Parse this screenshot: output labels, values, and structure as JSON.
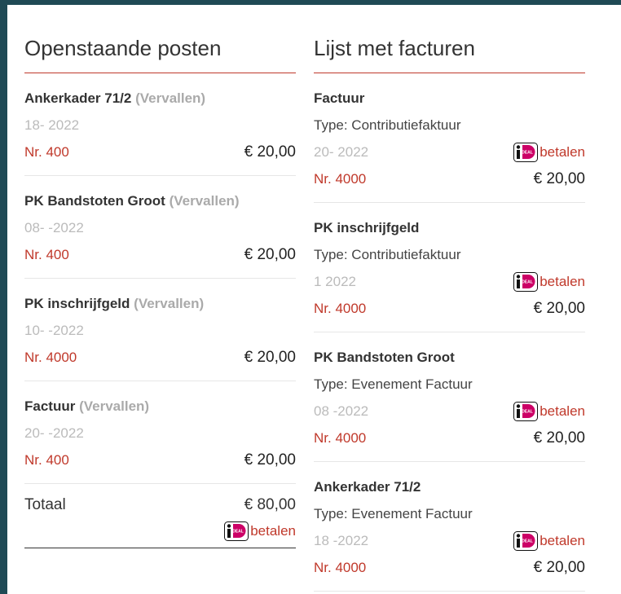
{
  "left": {
    "heading": "Openstaande posten",
    "items": [
      {
        "title": "Ankerkader 71/2",
        "status": "(Vervallen)",
        "date": "18-   2022",
        "nr": "Nr. 400",
        "amount": "€ 20,00"
      },
      {
        "title": "PK Bandstoten Groot",
        "status": "(Vervallen)",
        "date": "08-   -2022",
        "nr": "Nr. 400",
        "amount": "€ 20,00"
      },
      {
        "title": "PK inschrijfgeld",
        "status": "(Vervallen)",
        "date": "10-     -2022",
        "nr": "Nr. 4000",
        "amount": "€ 20,00"
      },
      {
        "title": "Factuur",
        "status": "(Vervallen)",
        "date": "20-   -2022",
        "nr": "Nr. 400",
        "amount": "€ 20,00"
      }
    ],
    "total_label": "Totaal",
    "total_amount": "€ 80,00",
    "pay_label": "betalen"
  },
  "right": {
    "heading": "Lijst met facturen",
    "items": [
      {
        "title": "Factuur",
        "type": "Type: Contributiefaktuur",
        "date": "20-     2022",
        "nr": "Nr. 4000",
        "amount": "€ 20,00",
        "pay": "betalen"
      },
      {
        "title": "PK inschrijfgeld",
        "type": "Type: Contributiefaktuur",
        "date": "1     2022",
        "nr": "Nr. 4000",
        "amount": "€ 20,00",
        "pay": "betalen"
      },
      {
        "title": "PK Bandstoten Groot",
        "type": "Type: Evenement Factuur",
        "date": "08     -2022",
        "nr": "Nr. 4000",
        "amount": "€ 20,00",
        "pay": "betalen"
      },
      {
        "title": "Ankerkader 71/2",
        "type": "Type: Evenement Factuur",
        "date": "18    -2022",
        "nr": "Nr. 4000",
        "amount": "€ 20,00",
        "pay": "betalen"
      }
    ]
  },
  "colors": {
    "accent": "#c0392b",
    "ideal_pink": "#cc0066",
    "background": "#1f4a55"
  },
  "icons": {
    "ideal": "ideal-logo-icon"
  }
}
